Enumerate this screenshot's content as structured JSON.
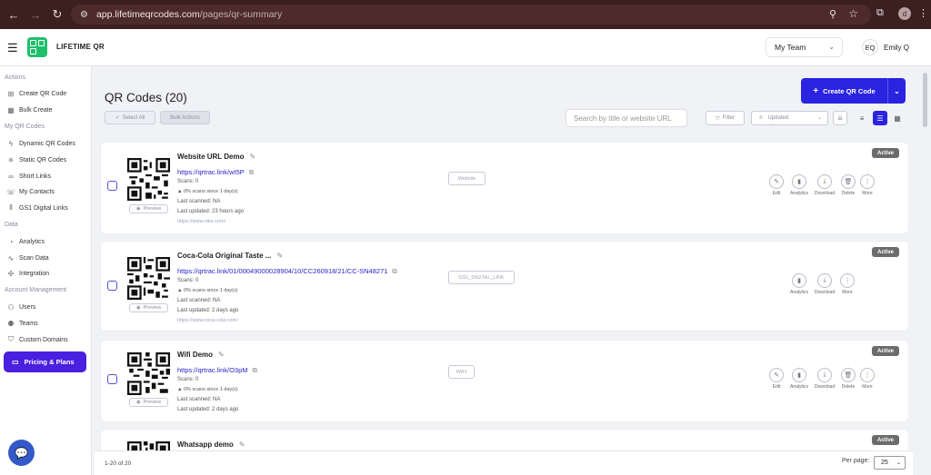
{
  "browser": {
    "url_host": "app.lifetimeqrcodes.com",
    "url_path": "/pages/qr-summary",
    "profile_initial": "d"
  },
  "header": {
    "brand": "LIFETIME QR",
    "team": "My Team",
    "user_initials": "EQ",
    "user_name": "Emily Q"
  },
  "sidebar": {
    "sections": [
      {
        "title": "Actions",
        "items": [
          "Create QR Code",
          "Bulk Create"
        ]
      },
      {
        "title": "My QR Codes",
        "items": [
          "Dynamic QR Codes",
          "Static QR Codes",
          "Short Links",
          "My Contacts",
          "GS1 Digital Links"
        ]
      },
      {
        "title": "Data",
        "items": [
          "Analytics",
          "Scan Data",
          "Integration"
        ]
      },
      {
        "title": "Account Management",
        "items": [
          "Users",
          "Teams",
          "Custom Domains"
        ]
      }
    ],
    "plan_button": "Pricing & Plans"
  },
  "main": {
    "title": "QR Codes (20)",
    "select_all": "Select All",
    "bulk_actions": "Bulk Actions",
    "search_placeholder": "Search by title or website URL",
    "filter": "Filter",
    "sort": "Updated",
    "create_button": "Create QR Code"
  },
  "cards": [
    {
      "name": "Website URL Demo",
      "link": "https://qrtrac.link/wI5P",
      "scans": "Scans: 0",
      "since": "0% scans since 1 day(s)",
      "last_scanned": "Last scanned: NA",
      "last_updated": "Last updated: 23 hours ago",
      "url": "https://www.nike.com/",
      "type": "Website",
      "status": "Active",
      "actions": [
        "Edit",
        "Analytics",
        "Download",
        "Delete",
        "More"
      ]
    },
    {
      "name": "Coca-Cola Original Taste ...",
      "link": "https://qrtrac.link/01/00049000028904/10/CC260918/21/CC-SN48271",
      "scans": "Scans: 0",
      "since": "0% scans since 1 day(s)",
      "last_scanned": "Last scanned: NA",
      "last_updated": "Last updated: 2 days ago",
      "url": "https://www.coca-cola.com/",
      "type": "GS1_DIGITAL_LINK",
      "status": "Active",
      "actions": [
        "Analytics",
        "Download",
        "More"
      ]
    },
    {
      "name": "Wifi Demo",
      "link": "https://qrtrac.link/O3pM",
      "scans": "Scans: 0",
      "since": "0% scans since 1 day(s)",
      "last_scanned": "Last scanned: NA",
      "last_updated": "Last updated: 2 days ago",
      "type": "WIFI",
      "status": "Active",
      "actions": [
        "Edit",
        "Analytics",
        "Download",
        "Delete",
        "More"
      ]
    },
    {
      "name": "Whatsapp demo",
      "status": "Active"
    }
  ],
  "preview_label": "Preview",
  "footer": {
    "range": "1-20 of 20",
    "per_page_label": "Per page:",
    "per_page": "25"
  }
}
